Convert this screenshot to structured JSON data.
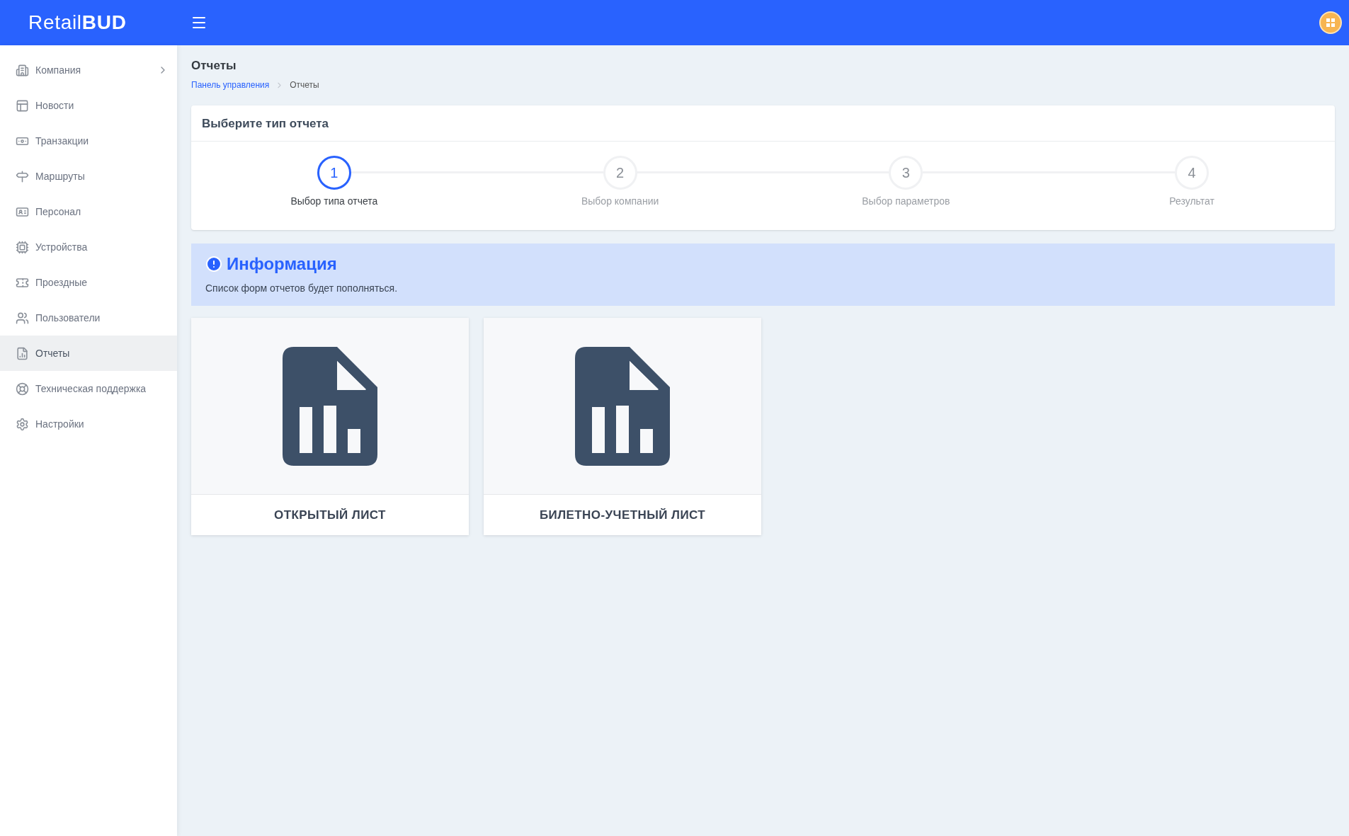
{
  "header": {
    "logo": "Retail**BUD**"
  },
  "sidebar": {
    "items": [
      {
        "label": "Компания",
        "kind": "building",
        "selected": false,
        "has_children": true
      },
      {
        "label": "Новости",
        "kind": "news",
        "selected": false,
        "has_children": false
      },
      {
        "label": "Транзакции",
        "kind": "money",
        "selected": false,
        "has_children": false
      },
      {
        "label": "Маршруты",
        "kind": "signpost",
        "selected": false,
        "has_children": false
      },
      {
        "label": "Персонал",
        "kind": "badge",
        "selected": false,
        "has_children": false
      },
      {
        "label": "Устройства",
        "kind": "chip",
        "selected": false,
        "has_children": false
      },
      {
        "label": "Проездные",
        "kind": "ticket",
        "selected": false,
        "has_children": false
      },
      {
        "label": "Пользователи",
        "kind": "users",
        "selected": false,
        "has_children": false
      },
      {
        "label": "Отчеты",
        "kind": "report",
        "selected": true,
        "has_children": false
      },
      {
        "label": "Техническая поддержка",
        "kind": "support",
        "selected": false,
        "has_children": false
      },
      {
        "label": "Настройки",
        "kind": "settings",
        "selected": false,
        "has_children": false
      }
    ]
  },
  "page": {
    "title": "Отчеты",
    "breadcrumb": [
      {
        "label": "Панель управления",
        "kind": "link"
      },
      {
        "label": "Отчеты",
        "kind": "current"
      }
    ]
  },
  "wizard": {
    "title": "Выберите тип отчета",
    "steps": [
      {
        "number": "1",
        "label": "Выбор типа отчета",
        "selected": true
      },
      {
        "number": "2",
        "label": "Выбор компании",
        "selected": false
      },
      {
        "number": "3",
        "label": "Выбор параметров",
        "selected": false
      },
      {
        "number": "4",
        "label": "Результат",
        "selected": false
      }
    ]
  },
  "info": {
    "title": "Информация",
    "text": "Список форм отчетов будет пополняться."
  },
  "report_types": [
    {
      "label": "ОТКРЫТЫЙ ЛИСТ"
    },
    {
      "label": "БИЛЕТНО-УЧЕТНЫЙ ЛИСТ"
    }
  ]
}
